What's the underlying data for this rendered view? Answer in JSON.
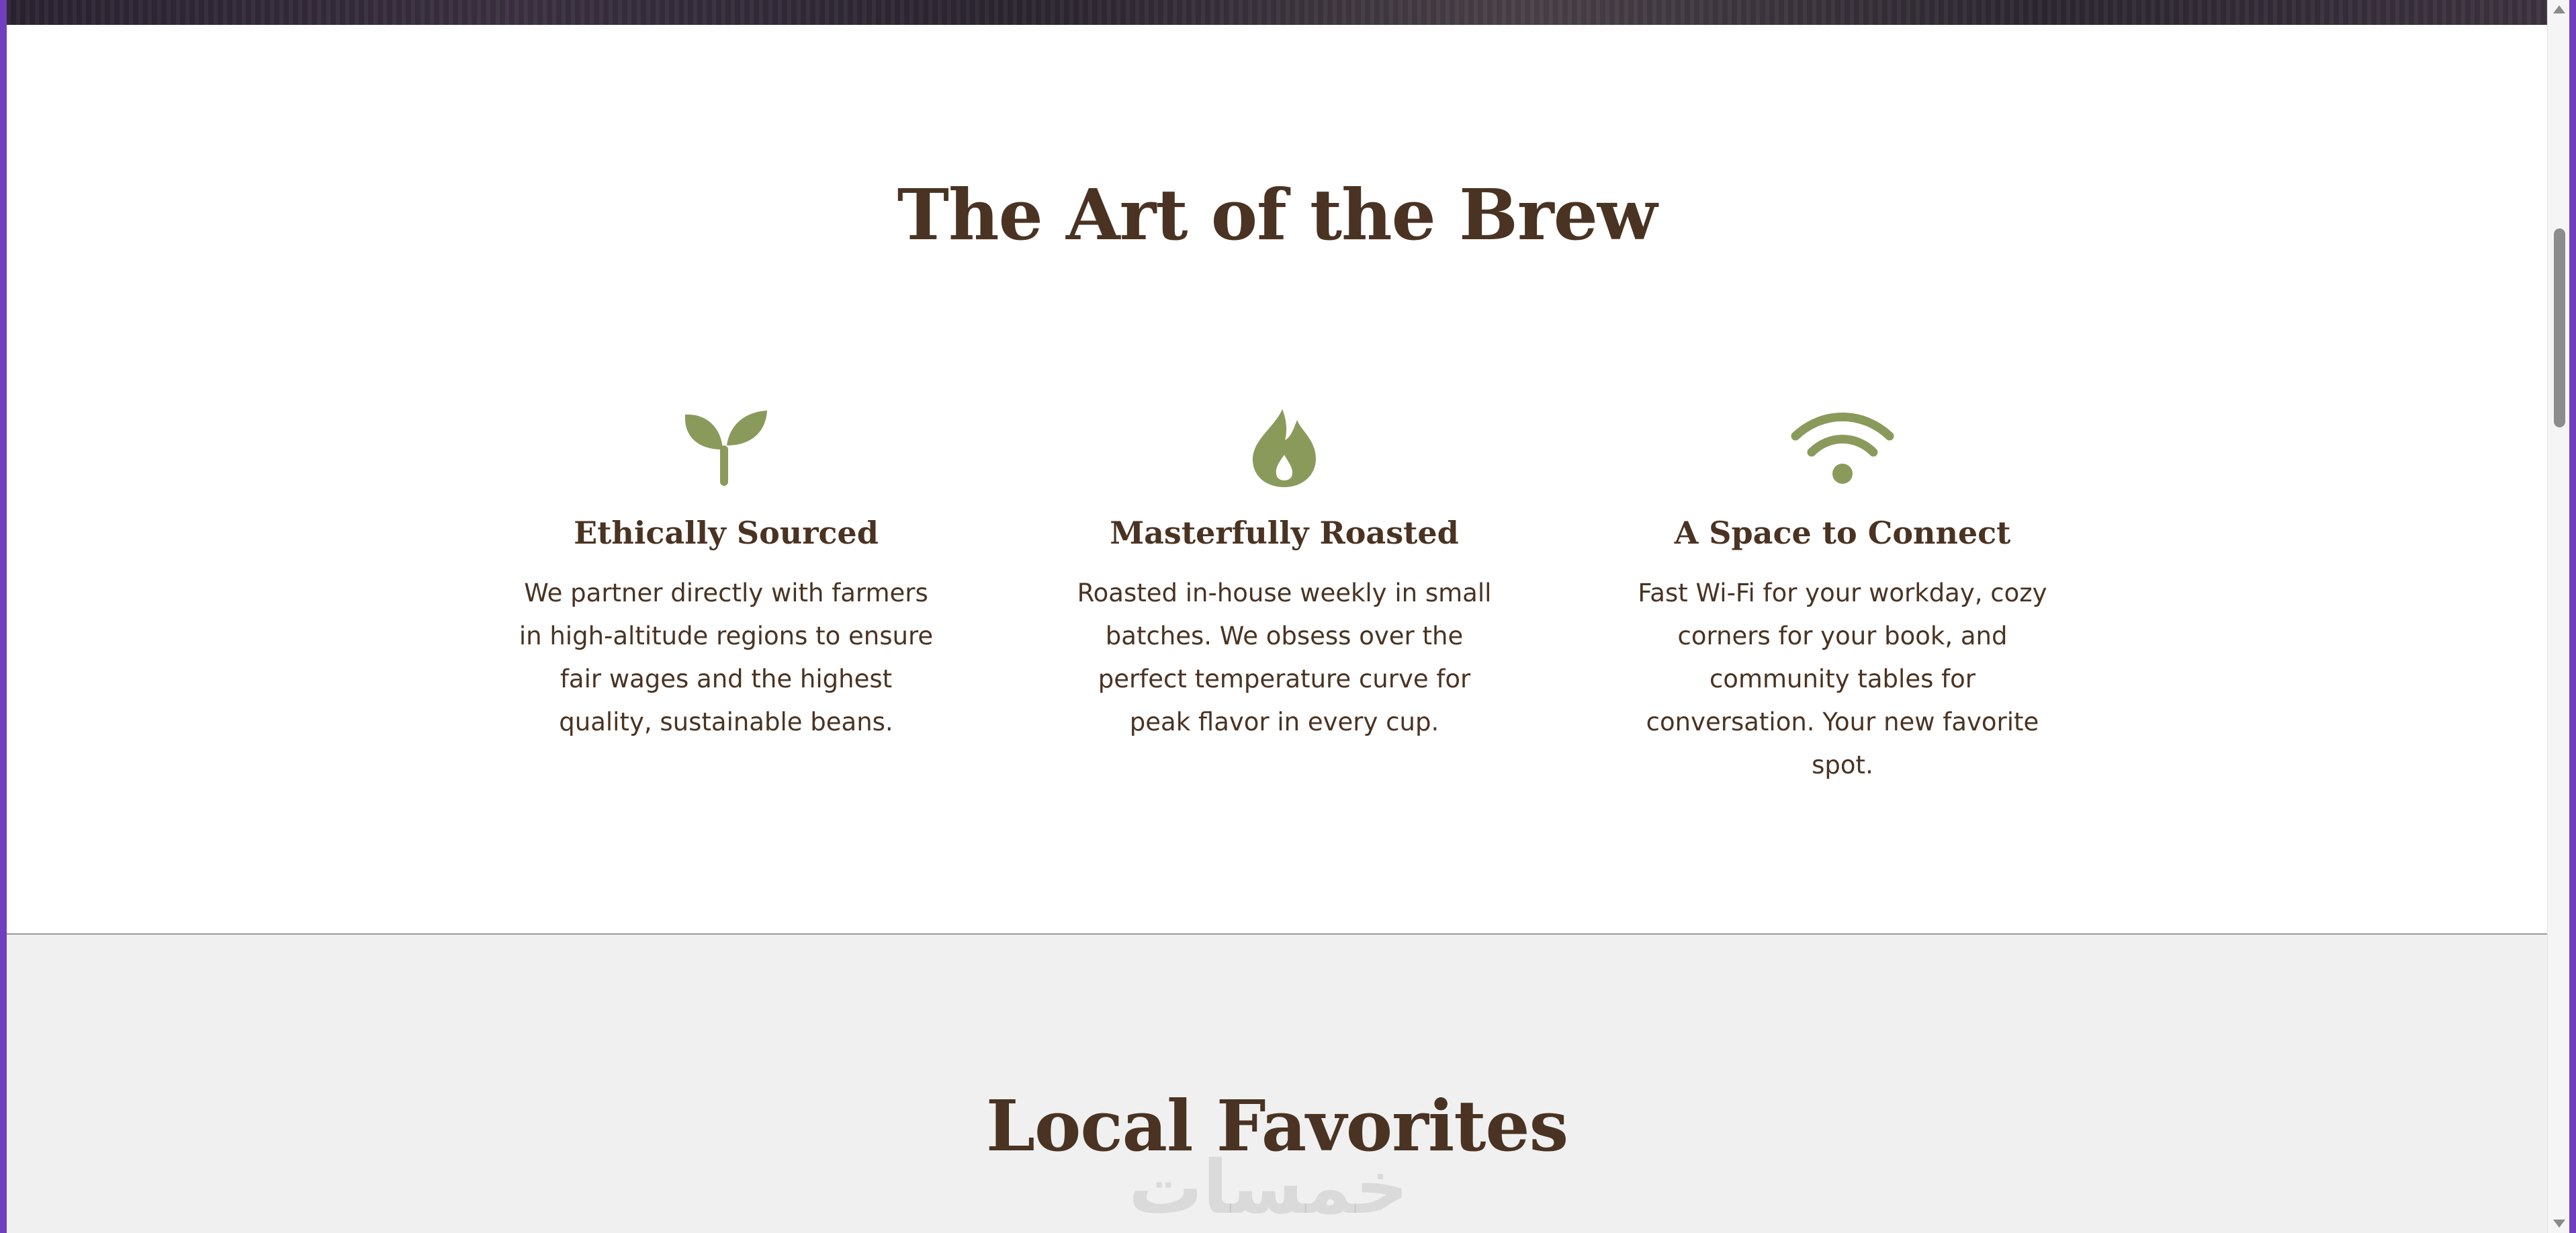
{
  "brew": {
    "title": "The Art of the Brew",
    "features": [
      {
        "icon": "sprout-icon",
        "title": "Ethically Sourced",
        "text": "We partner directly with farmers in high-altitude regions to ensure fair wages and the highest quality, sustainable beans."
      },
      {
        "icon": "flame-icon",
        "title": "Masterfully Roasted",
        "text": "Roasted in-house weekly in small batches. We obsess over the perfect temperature curve for peak flavor in every cup."
      },
      {
        "icon": "wifi-icon",
        "title": "A Space to Connect",
        "text": "Fast Wi-Fi for your workday, cozy corners for your book, and community tables for conversation. Your new favorite spot."
      }
    ]
  },
  "favorites": {
    "title": "Local Favorites"
  },
  "watermark": "خمسات",
  "colors": {
    "heading": "#4a3322",
    "icon": "#8a9a5b",
    "section_alt_bg": "#f0f0f0",
    "frame": "#6f3fbf"
  }
}
